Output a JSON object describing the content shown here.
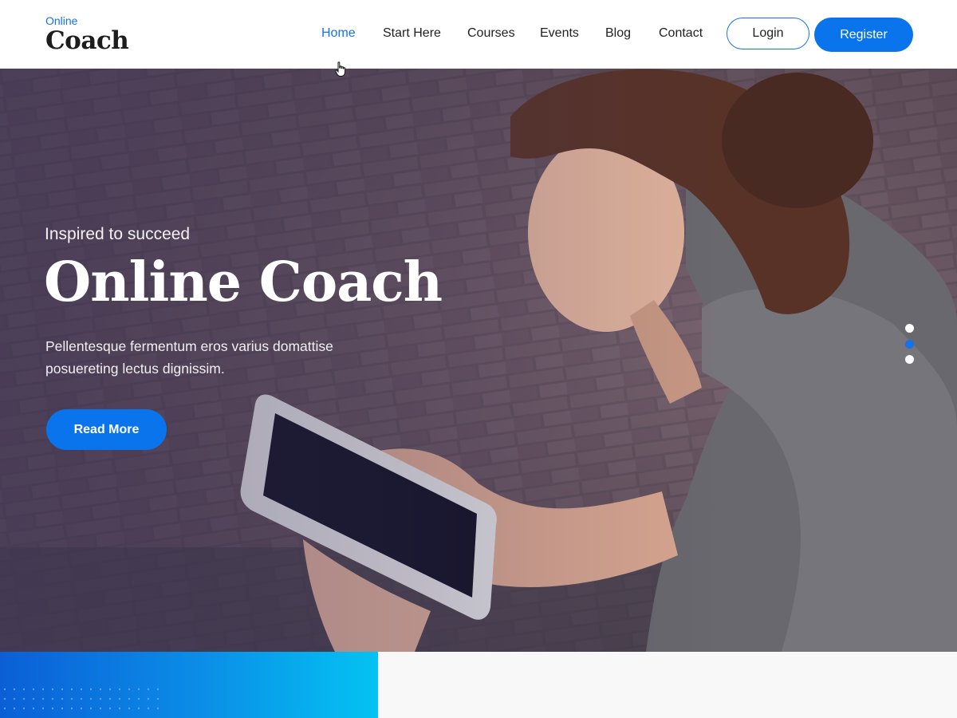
{
  "logo": {
    "small": "Online",
    "big": "Coach"
  },
  "nav": {
    "items": [
      {
        "label": "Home",
        "active": true
      },
      {
        "label": "Start Here"
      },
      {
        "label": "Courses"
      },
      {
        "label": "Events"
      },
      {
        "label": "Blog"
      },
      {
        "label": "Contact"
      }
    ],
    "login_label": "Login",
    "register_label": "Register"
  },
  "hero": {
    "kicker": "Inspired to succeed",
    "title": "Online Coach",
    "description": "Pellentesque fermentum eros varius domattise posuereting lectus dignissim.",
    "button_label": "Read More",
    "slider_dots": 3,
    "active_slide": 2
  },
  "colors": {
    "accent": "#1673e6",
    "button": "#0a74ec"
  }
}
